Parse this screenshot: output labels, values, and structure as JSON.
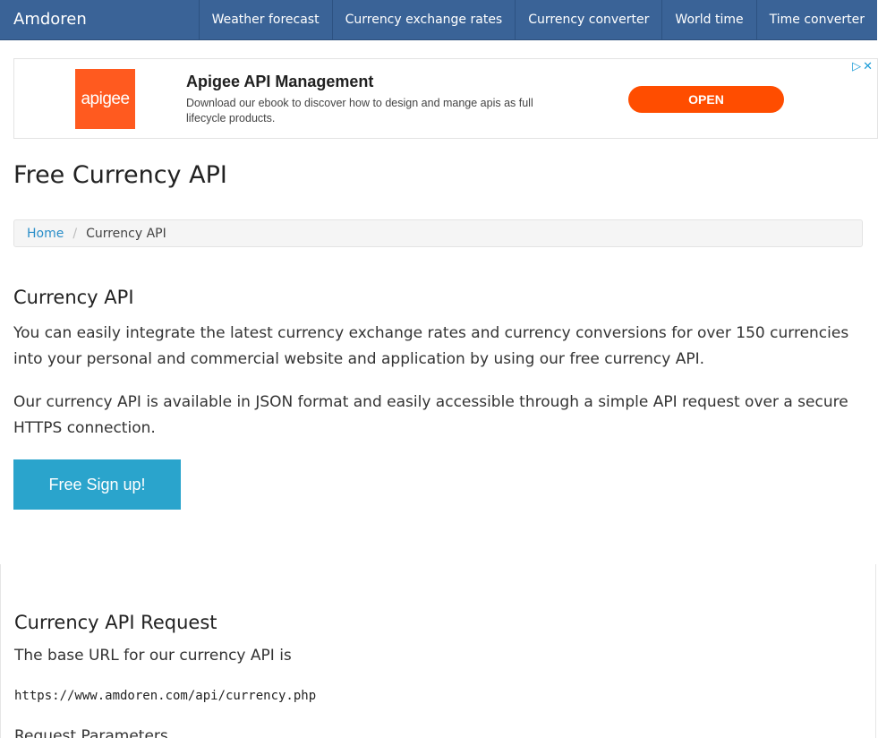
{
  "navbar": {
    "brand": "Amdoren",
    "items": [
      "Weather forecast",
      "Currency exchange rates",
      "Currency converter",
      "World time",
      "Time converter"
    ]
  },
  "ad": {
    "logo_text": "apigee",
    "title": "Apigee API Management",
    "description": "Download our ebook to discover how to design and mange apis as full lifecycle products.",
    "button_label": "OPEN",
    "choices_icons": [
      "adchoices-icon",
      "close-icon"
    ],
    "colors": {
      "logo": "#ff5a1f",
      "button": "#ff4d00"
    }
  },
  "page_title": "Free Currency API",
  "breadcrumb": {
    "home": "Home",
    "separator": "/",
    "current": "Currency API"
  },
  "intro": {
    "heading": "Currency API",
    "para1": "You can easily integrate the latest currency exchange rates and currency conversions for over 150 currencies into your personal and commercial website and application by using our free currency API.",
    "para2": "Our currency API is available in JSON format and easily accessible through a simple API request over a secure HTTPS connection.",
    "signup_label": "Free Sign up!"
  },
  "request": {
    "heading": "Currency API Request",
    "base_text": "The base URL for our currency API is",
    "base_url": "https://www.amdoren.com/api/currency.php",
    "params_heading": "Request Parameters"
  },
  "colors": {
    "navbar": "#3a6397",
    "accent": "#2aa4cc",
    "link": "#2a8ec9"
  }
}
